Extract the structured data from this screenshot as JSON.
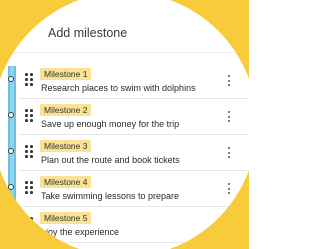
{
  "header": {
    "title": "Add milestone"
  },
  "milestones": [
    {
      "badge": "Milestone 1",
      "text": "Research places to swim with dolphins"
    },
    {
      "badge": "Milestone 2",
      "text": "Save up enough money for the trip"
    },
    {
      "badge": "Milestone 3",
      "text": "Plan out the route and book tickets"
    },
    {
      "badge": "Milestone 4",
      "text": "Take swimming lessons to prepare"
    },
    {
      "badge": "Milestone 5",
      "text": "njoy the experience"
    }
  ],
  "icons": {
    "drag": "drag-handle-icon",
    "more": "more-vertical-icon",
    "node": "timeline-node-icon"
  },
  "colors": {
    "frame": "#F7CB3A",
    "badge": "#F9E196",
    "track": "#8FD3EC"
  }
}
